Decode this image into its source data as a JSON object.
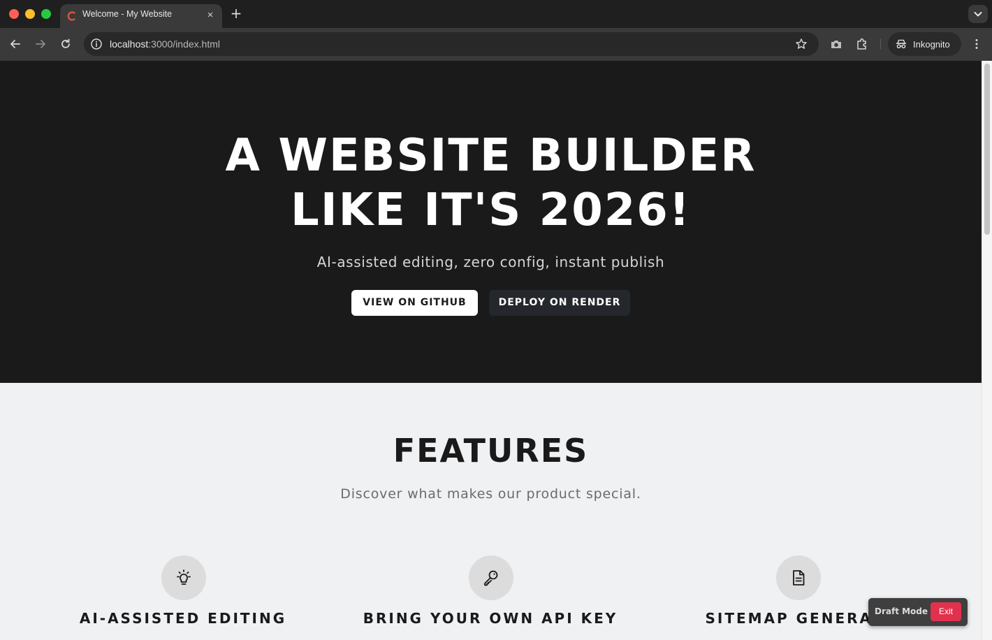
{
  "browser": {
    "tab_title": "Welcome - My Website",
    "tab_close": "×",
    "new_tab": "+",
    "url_host": "localhost",
    "url_path": ":3000/index.html",
    "incognito_label": "Inkognito"
  },
  "hero": {
    "title_line1": "A WEBSITE BUILDER",
    "title_line2": "LIKE IT'S 2026!",
    "subtitle": "AI-assisted editing, zero config, instant publish",
    "primary_button": "VIEW ON GITHUB",
    "secondary_button": "DEPLOY ON RENDER"
  },
  "features": {
    "title": "FEATURES",
    "subtitle": "Discover what makes our product special.",
    "items": [
      {
        "icon": "lightbulb-icon",
        "title": "AI-ASSISTED EDITING"
      },
      {
        "icon": "key-icon",
        "title": "BRING YOUR OWN API KEY"
      },
      {
        "icon": "document-icon",
        "title": "SITEMAP GENERATI"
      }
    ]
  },
  "draft_mode": {
    "label": "Draft Mode",
    "exit_label": "Exit"
  },
  "colors": {
    "hero_bg": "#1a1a1a",
    "page_bg": "#f0f1f3",
    "exit_button": "#e0324d"
  }
}
